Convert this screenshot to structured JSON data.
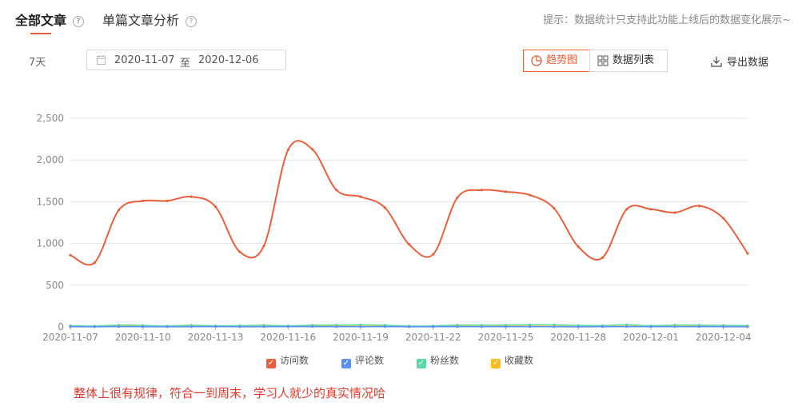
{
  "tabs": [
    {
      "label": "全部文章",
      "active": true
    },
    {
      "label": "单篇文章分析",
      "active": false
    }
  ],
  "hint": "提示：数据统计只支持此功能上线后的数据变化展示~",
  "range_label": "7天",
  "date_range": {
    "start": "2020-11-07",
    "separator": "至",
    "end": "2020-12-06"
  },
  "view_buttons": [
    {
      "label": "趋势图",
      "icon": "trend-chart-icon",
      "active": true
    },
    {
      "label": "数据列表",
      "icon": "grid-list-icon",
      "active": false
    }
  ],
  "export_label": "导出数据",
  "accent_color": "#e8603c",
  "chart_data": {
    "type": "line",
    "x": [
      "2020-11-07",
      "2020-11-08",
      "2020-11-09",
      "2020-11-10",
      "2020-11-11",
      "2020-11-12",
      "2020-11-13",
      "2020-11-14",
      "2020-11-15",
      "2020-11-16",
      "2020-11-17",
      "2020-11-18",
      "2020-11-19",
      "2020-11-20",
      "2020-11-21",
      "2020-11-22",
      "2020-11-23",
      "2020-11-24",
      "2020-11-25",
      "2020-11-26",
      "2020-11-27",
      "2020-11-28",
      "2020-11-29",
      "2020-11-30",
      "2020-12-01",
      "2020-12-02",
      "2020-12-03",
      "2020-12-04",
      "2020-12-05"
    ],
    "x_tick_labels": [
      "2020-11-07",
      "2020-11-10",
      "2020-11-13",
      "2020-11-16",
      "2020-11-19",
      "2020-11-22",
      "2020-11-25",
      "2020-11-28",
      "2020-12-01",
      "2020-12-04"
    ],
    "ylim": [
      0,
      2500
    ],
    "y_ticks": [
      "0",
      "500",
      "1,000",
      "1,500",
      "2,000",
      "2,500"
    ],
    "grid": true,
    "legend_position": "bottom-center",
    "series": [
      {
        "name": "访问数",
        "color": "#e8603c",
        "values": [
          860,
          770,
          1400,
          1510,
          1510,
          1560,
          1440,
          900,
          970,
          2120,
          2130,
          1640,
          1560,
          1430,
          990,
          870,
          1550,
          1640,
          1620,
          1580,
          1420,
          960,
          830,
          1410,
          1410,
          1370,
          1450,
          1300,
          880
        ]
      },
      {
        "name": "评论数",
        "color": "#5b8ff9",
        "values": [
          2,
          1,
          3,
          2,
          1,
          2,
          3,
          1,
          2,
          3,
          4,
          2,
          2,
          3,
          1,
          2,
          3,
          2,
          2,
          3,
          2,
          1,
          2,
          3,
          2,
          2,
          3,
          2,
          1
        ]
      },
      {
        "name": "粉丝数",
        "color": "#5ad8a6",
        "values": [
          15,
          10,
          22,
          18,
          10,
          20,
          12,
          15,
          20,
          12,
          20,
          22,
          24,
          20,
          10,
          12,
          22,
          20,
          22,
          25,
          24,
          18,
          16,
          25,
          14,
          22,
          20,
          18,
          15
        ]
      },
      {
        "name": "收藏数",
        "color": "#f6bd16",
        "values": [
          5,
          3,
          8,
          6,
          4,
          7,
          5,
          4,
          6,
          5,
          7,
          8,
          8,
          6,
          3,
          4,
          7,
          6,
          7,
          8,
          7,
          5,
          4,
          8,
          5,
          7,
          6,
          5,
          4
        ]
      }
    ]
  },
  "note": "整体上很有规律，符合一到周末，学习人就少的真实情况哈"
}
